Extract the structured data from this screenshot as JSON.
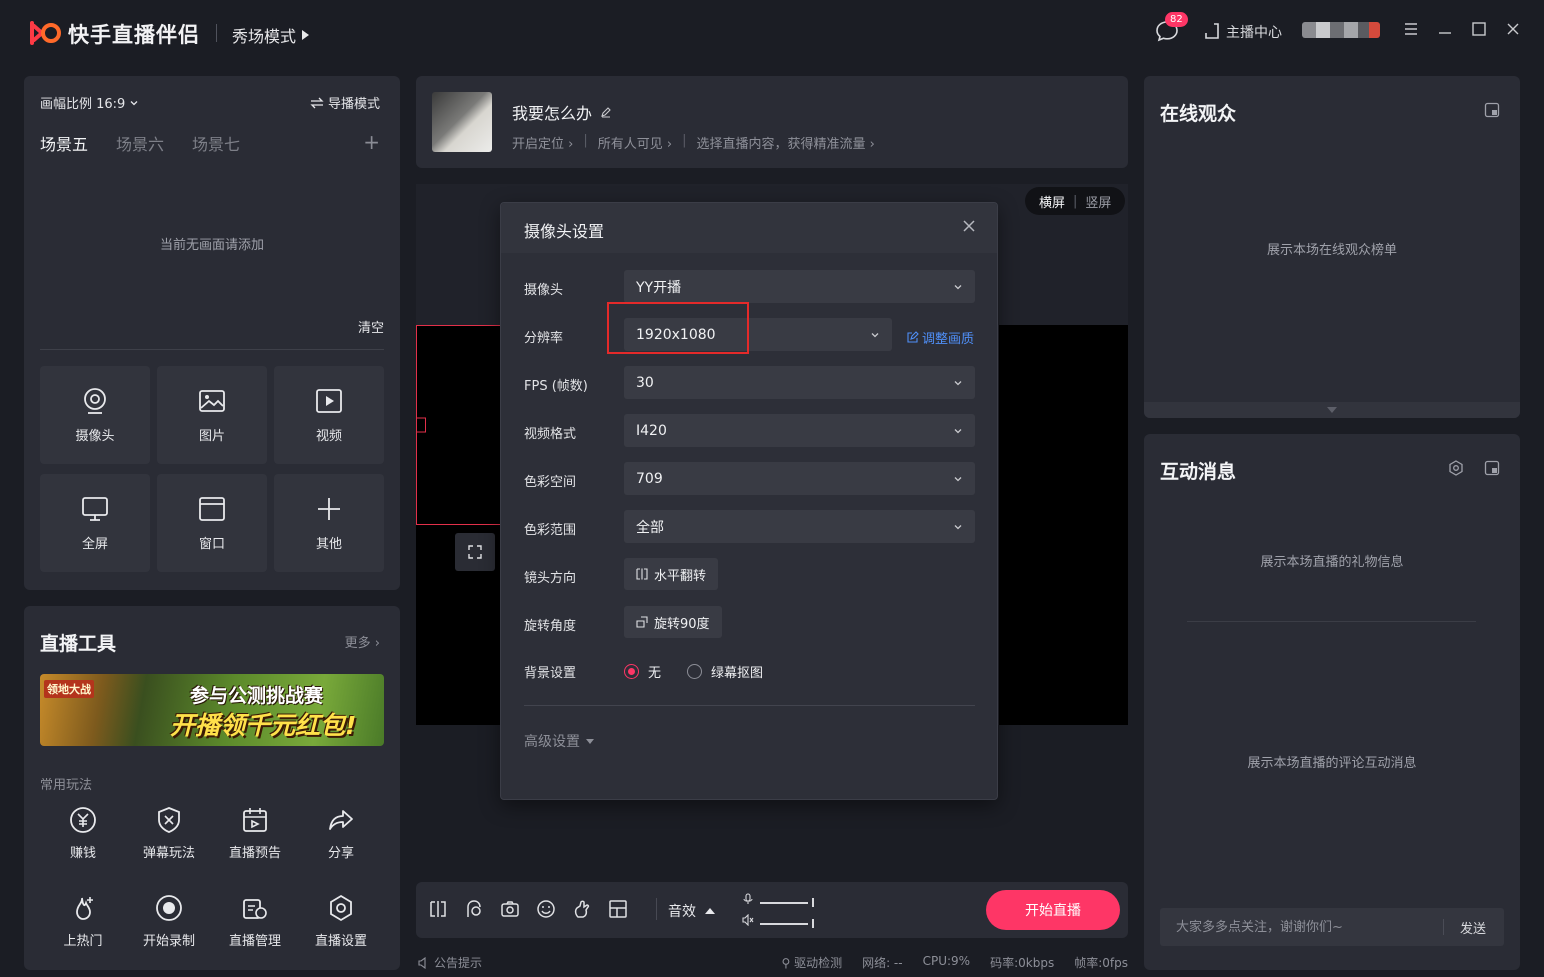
{
  "app": {
    "name": "快手直播伴侣",
    "mode": "秀场模式",
    "notification_count": "82",
    "anchor_center": "主播中心",
    "brand_color": "#fe3666"
  },
  "scene_panel": {
    "ratio": "画幅比例 16:9",
    "guide_mode": "导播模式",
    "tabs": [
      "场景五",
      "场景六",
      "场景七"
    ],
    "active_tab": "场景五",
    "empty_hint": "当前无画面请添加",
    "clear": "清空",
    "sources": [
      {
        "label": "摄像头",
        "icon": "camera-icon"
      },
      {
        "label": "图片",
        "icon": "image-icon"
      },
      {
        "label": "视频",
        "icon": "video-icon"
      },
      {
        "label": "全屏",
        "icon": "monitor-icon"
      },
      {
        "label": "窗口",
        "icon": "window-icon"
      },
      {
        "label": "其他",
        "icon": "plus-icon"
      }
    ]
  },
  "tools": {
    "title": "直播工具",
    "more": "更多",
    "banner": {
      "tag": "领地大战",
      "line1": "参与公测挑战赛",
      "line2": "开播领千元红包!"
    },
    "common_label": "常用玩法",
    "items": [
      {
        "label": "赚钱",
        "icon": "yuan-icon"
      },
      {
        "label": "弹幕玩法",
        "icon": "shield-game-icon"
      },
      {
        "label": "直播预告",
        "icon": "calendar-icon"
      },
      {
        "label": "分享",
        "icon": "share-icon"
      },
      {
        "label": "上热门",
        "icon": "fire-icon"
      },
      {
        "label": "开始录制",
        "icon": "record-icon"
      },
      {
        "label": "直播管理",
        "icon": "manage-icon"
      },
      {
        "label": "直播设置",
        "icon": "settings-icon"
      }
    ]
  },
  "live_header": {
    "title": "我要怎么办",
    "meta": [
      "开启定位 ›",
      "所有人可见 ›",
      "选择直播内容，获得精准流量 ›"
    ]
  },
  "preview": {
    "orientation": [
      "横屏",
      "竖屏"
    ],
    "active_orientation": "横屏"
  },
  "dialog": {
    "title": "摄像头设置",
    "rows": {
      "camera": {
        "label": "摄像头",
        "value": "YY开播"
      },
      "resolution": {
        "label": "分辨率",
        "value": "1920x1080",
        "link": "调整画质"
      },
      "fps": {
        "label": "FPS (帧数)",
        "value": "30"
      },
      "format": {
        "label": "视频格式",
        "value": "I420"
      },
      "colorspace": {
        "label": "色彩空间",
        "value": "709"
      },
      "colorrange": {
        "label": "色彩范围",
        "value": "全部"
      },
      "mirror": {
        "label": "镜头方向",
        "button": "水平翻转"
      },
      "rotate": {
        "label": "旋转角度",
        "button": "旋转90度"
      },
      "background": {
        "label": "背景设置",
        "options": [
          "无",
          "绿幕抠图"
        ],
        "selected": "无"
      }
    },
    "advanced": "高级设置"
  },
  "bottom_bar": {
    "sound": "音效",
    "start_live": "开始直播"
  },
  "status_bar": {
    "notice": "公告提示",
    "driver_check": "驱动检测",
    "network": "网络: --",
    "cpu": "CPU:9%",
    "bitrate": "码率:0kbps",
    "framerate": "帧率:0fps"
  },
  "audience": {
    "title": "在线观众",
    "hint": "展示本场在线观众榜单"
  },
  "messages": {
    "title": "互动消息",
    "gift_hint": "展示本场直播的礼物信息",
    "comment_hint": "展示本场直播的评论互动消息",
    "input_placeholder": "大家多多点关注，谢谢你们~",
    "send": "发送"
  }
}
